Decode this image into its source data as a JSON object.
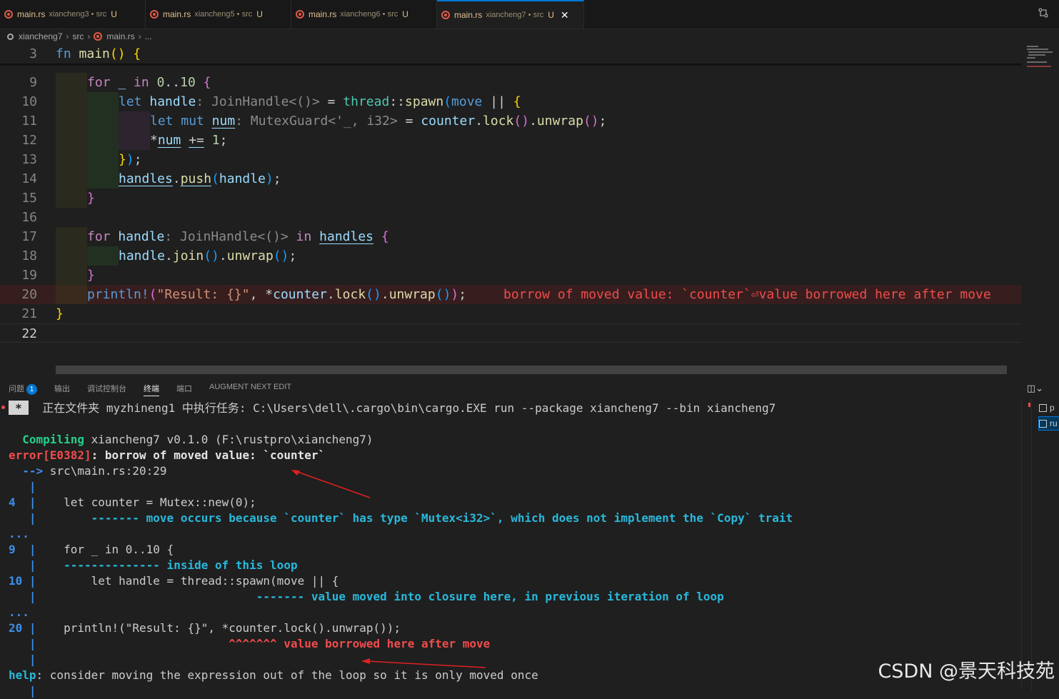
{
  "tabs": [
    {
      "file": "main.rs",
      "desc": "xiancheng3 • src",
      "status": "U",
      "active": false
    },
    {
      "file": "main.rs",
      "desc": "xiancheng5 • src",
      "status": "U",
      "active": false
    },
    {
      "file": "main.rs",
      "desc": "xiancheng6 • src",
      "status": "U",
      "active": false
    },
    {
      "file": "main.rs",
      "desc": "xiancheng7 • src",
      "status": "U",
      "active": true
    }
  ],
  "tab_close": "✕",
  "breadcrumb": [
    "xiancheng7",
    "src",
    "main.rs",
    "..."
  ],
  "editor": {
    "lines": [
      {
        "n": "3"
      },
      {
        "n": "9"
      },
      {
        "n": "10"
      },
      {
        "n": "11"
      },
      {
        "n": "12"
      },
      {
        "n": "13"
      },
      {
        "n": "14"
      },
      {
        "n": "15"
      },
      {
        "n": "16"
      },
      {
        "n": "17"
      },
      {
        "n": "18"
      },
      {
        "n": "19"
      },
      {
        "n": "20"
      },
      {
        "n": "21"
      },
      {
        "n": "22"
      }
    ],
    "error_inline": "borrow of moved value: `counter`⏎value borrowed here after move"
  },
  "panel": {
    "tabs": [
      "问题",
      "输出",
      "调试控制台",
      "终端",
      "端口",
      "AUGMENT NEXT EDIT"
    ],
    "active_tab": "终端",
    "problems_count": "1"
  },
  "terminal": {
    "task_icon": "*",
    "task_line": "正在文件夹 myzhineng1 中执行任务: C:\\Users\\dell\\.cargo\\bin\\cargo.EXE run --package xiancheng7 --bin xiancheng7",
    "compiling_label": "Compiling",
    "compiling_rest": " xiancheng7 v0.1.0 (F:\\rustpro\\xiancheng7)",
    "error_code": "error[E0382]",
    "error_msg": ": borrow of moved value: `counter`",
    "location_arrow": "  -->",
    "location": " src\\main.rs:20:29",
    "gutter": "   |",
    "l4_num": "4",
    "l4_code": "    let counter = Mutex::new(0);",
    "l4_note": "        ------- move occurs because `counter` has type `Mutex<i32>`, which does not implement the `Copy` trait",
    "dots": "...",
    "l9_num": "9",
    "l9_code": "    for _ in 0..10 {",
    "l9_note": "    -------------- inside of this loop",
    "l10_num": "10",
    "l10_code": "        let handle = thread::spawn(move || {",
    "l10_note": "                                ------- value moved into closure here, in previous iteration of loop",
    "l20_num": "20",
    "l20_code": "    println!(\"Result: {}\", *counter.lock().unwrap());",
    "l20_note": "                            ^^^^^^^ value borrowed here after move",
    "help_label": "help",
    "help_msg": ": consider moving the expression out of the loop so it is only moved once",
    "side_items": [
      "p",
      "ru"
    ]
  },
  "watermark": "CSDN @景天科技苑"
}
